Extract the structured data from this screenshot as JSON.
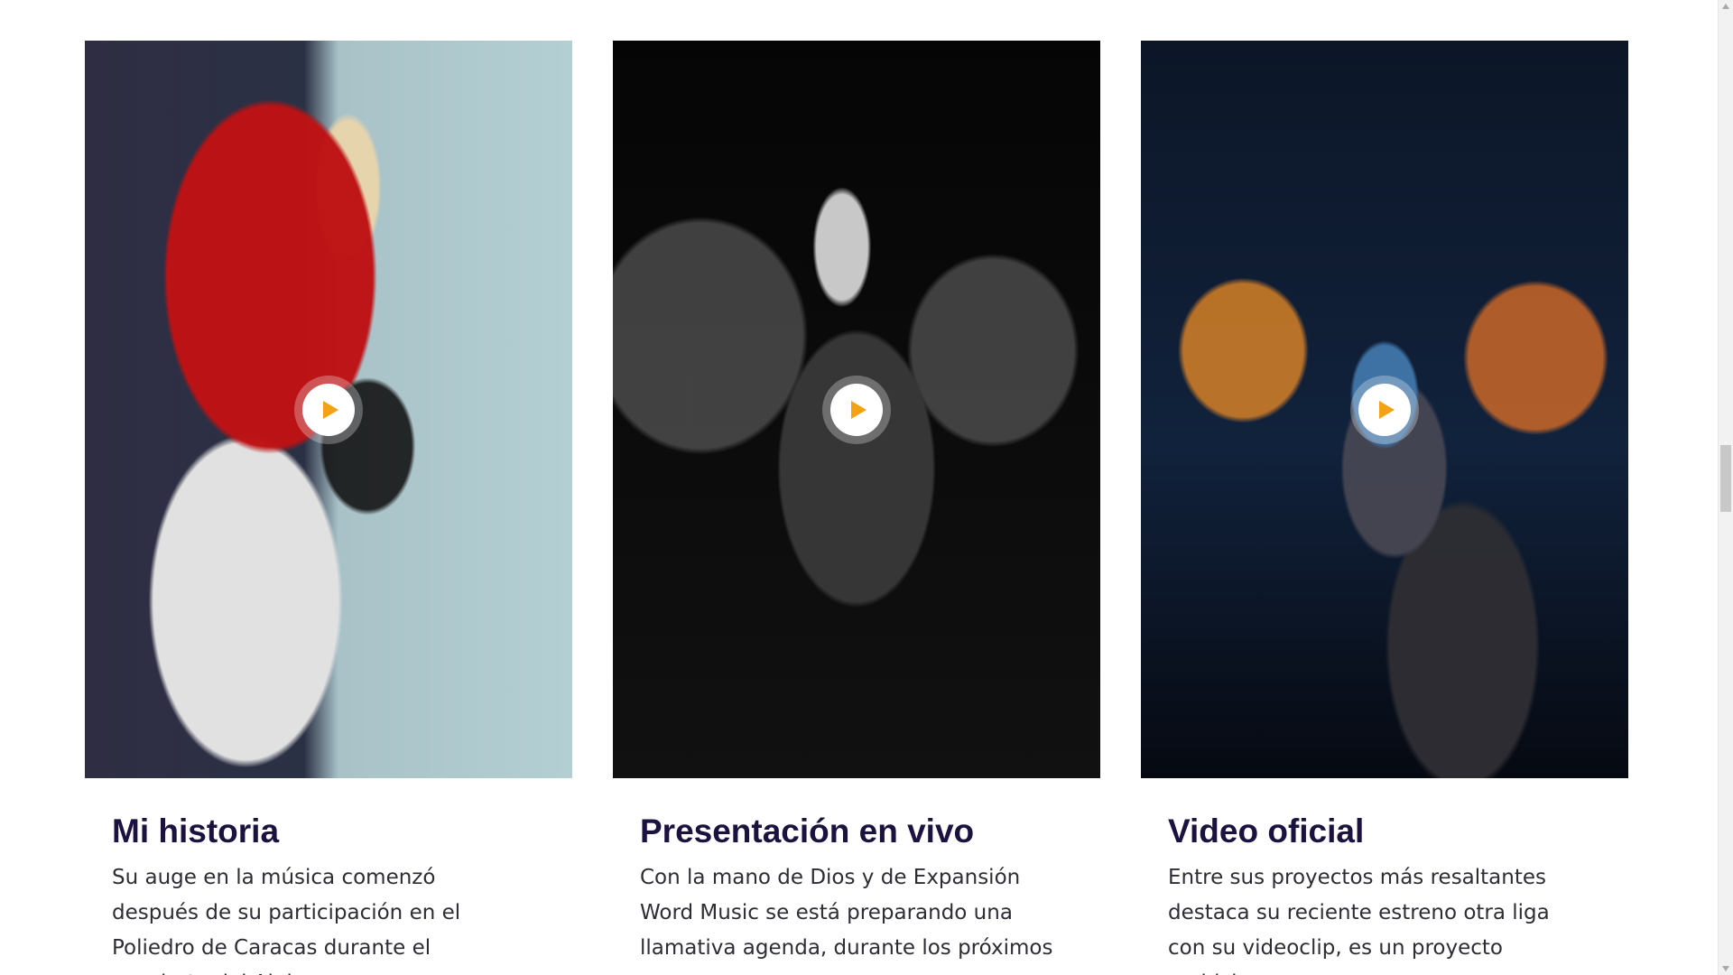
{
  "cards": [
    {
      "title": "Mi historia",
      "description": "Su auge en la música comenzó después de su participación en el Poliedro de Caracas durante el concierto del Alpha,"
    },
    {
      "title": "Presentación en vivo",
      "description": "Con la mano de Dios y de Expansión Word Music se está preparando una llamativa agenda, durante los próximos"
    },
    {
      "title": "Video oficial",
      "description": "Entre sus proyectos más resaltantes destaca su reciente estreno otra liga con su videoclip, es un proyecto ambicioso,"
    }
  ],
  "icons": {
    "play": "play-icon"
  },
  "colors": {
    "title": "#1b1240",
    "text": "#2d2d35",
    "play": "#f3a214"
  }
}
